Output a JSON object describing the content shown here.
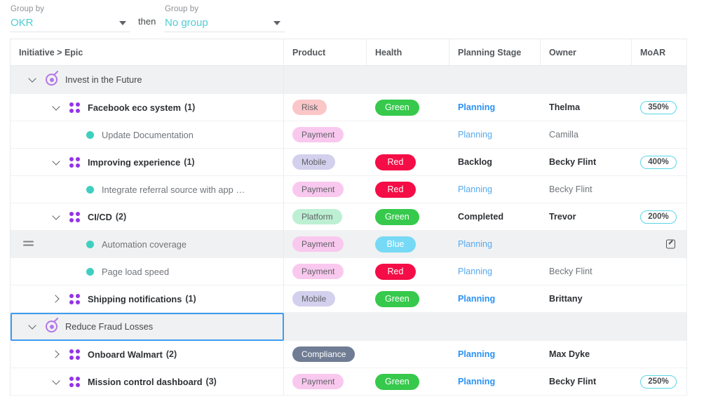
{
  "toolbar": {
    "group1": {
      "label": "Group by",
      "value": "OKR",
      "caret": "chevron-down-icon"
    },
    "then": "then",
    "group2": {
      "label": "Group by",
      "value": "No group",
      "caret": "chevron-down-icon"
    }
  },
  "table": {
    "columns": [
      "Initiative > Epic",
      "Product",
      "Health",
      "Planning Stage",
      "Owner",
      "MoAR"
    ],
    "rows": [
      {
        "kind": "okr",
        "indent": 0,
        "chevron": "down",
        "icon": "target-icon",
        "name": "Invest in the Future",
        "count": "",
        "product": "",
        "health": "",
        "stage": "",
        "owner": "",
        "moar": ""
      },
      {
        "kind": "epic",
        "indent": 1,
        "chevron": "down",
        "icon": "epic-grid-icon",
        "name": "Facebook eco system",
        "count": "(1)",
        "product": "Risk",
        "product_style": "risk",
        "health": "Green",
        "health_style": "green",
        "stage": "Planning",
        "stage_style": "link",
        "owner": "Thelma",
        "owner_style": "name",
        "moar": "350%"
      },
      {
        "kind": "story",
        "indent": 2,
        "chevron": "",
        "icon": "story-dot-icon",
        "name": "Update Documentation",
        "count": "",
        "product": "Payment",
        "product_style": "payment",
        "health": "",
        "health_style": "",
        "stage": "Planning",
        "stage_style": "link-lite",
        "owner": "Camilla",
        "owner_style": "name-lite",
        "moar": ""
      },
      {
        "kind": "epic",
        "indent": 1,
        "chevron": "down",
        "icon": "epic-grid-icon",
        "name": "Improving experience",
        "count": "(1)",
        "product": "Mobile",
        "product_style": "mobile",
        "health": "Red",
        "health_style": "red",
        "stage": "Backlog",
        "stage_style": "dark",
        "owner": "Becky Flint",
        "owner_style": "name",
        "moar": "400%"
      },
      {
        "kind": "story",
        "indent": 2,
        "chevron": "",
        "icon": "story-dot-icon",
        "name": "Integrate referral source with app …",
        "count": "",
        "product": "Payment",
        "product_style": "payment",
        "health": "Red",
        "health_style": "red",
        "stage": "Planning",
        "stage_style": "link-lite",
        "owner": "Becky Flint",
        "owner_style": "name-lite",
        "moar": ""
      },
      {
        "kind": "epic",
        "indent": 1,
        "chevron": "down",
        "icon": "epic-grid-icon",
        "name": "CI/CD",
        "count": "(2)",
        "product": "Platform",
        "product_style": "platform",
        "health": "Green",
        "health_style": "green",
        "stage": "Completed",
        "stage_style": "dark",
        "owner": "Trevor",
        "owner_style": "name",
        "moar": "200%"
      },
      {
        "kind": "story",
        "indent": 2,
        "chevron": "",
        "icon": "story-dot-icon",
        "name": "Automation coverage",
        "count": "",
        "hovered": true,
        "drag_handle": "drag-handle-icon",
        "open_icon": "external-link-icon",
        "product": "Payment",
        "product_style": "payment",
        "health": "Blue",
        "health_style": "blue",
        "stage": "Planning",
        "stage_style": "link-lite",
        "owner": "",
        "owner_style": "name-lite",
        "moar": ""
      },
      {
        "kind": "story",
        "indent": 2,
        "chevron": "",
        "icon": "story-dot-icon",
        "name": "Page load speed",
        "count": "",
        "product": "Payment",
        "product_style": "payment",
        "health": "Red",
        "health_style": "red",
        "stage": "Planning",
        "stage_style": "link-lite",
        "owner": "Becky Flint",
        "owner_style": "name-lite",
        "moar": ""
      },
      {
        "kind": "epic",
        "indent": 1,
        "chevron": "right",
        "icon": "epic-grid-icon",
        "name": "Shipping notifications",
        "count": "(1)",
        "product": "Mobile",
        "product_style": "mobile",
        "health": "Green",
        "health_style": "green",
        "stage": "Planning",
        "stage_style": "link",
        "owner": "Brittany",
        "owner_style": "name",
        "moar": ""
      },
      {
        "kind": "okr",
        "indent": 0,
        "chevron": "down",
        "icon": "target-icon",
        "name": "Reduce Fraud Losses",
        "count": "",
        "selected": true,
        "product": "",
        "health": "",
        "stage": "",
        "owner": "",
        "moar": ""
      },
      {
        "kind": "epic",
        "indent": 1,
        "chevron": "right",
        "icon": "epic-grid-icon",
        "name": "Onboard Walmart",
        "count": "(2)",
        "product": "Compliance",
        "product_style": "compliance",
        "health": "",
        "health_style": "",
        "stage": "Planning",
        "stage_style": "link",
        "owner": "Max Dyke",
        "owner_style": "name",
        "moar": ""
      },
      {
        "kind": "epic",
        "indent": 1,
        "chevron": "down",
        "icon": "epic-grid-icon",
        "name": "Mission control dashboard",
        "count": "(3)",
        "product": "Payment",
        "product_style": "payment",
        "health": "Green",
        "health_style": "green",
        "stage": "Planning",
        "stage_style": "link",
        "owner": "Becky Flint",
        "owner_style": "name",
        "moar": "250%"
      }
    ]
  }
}
